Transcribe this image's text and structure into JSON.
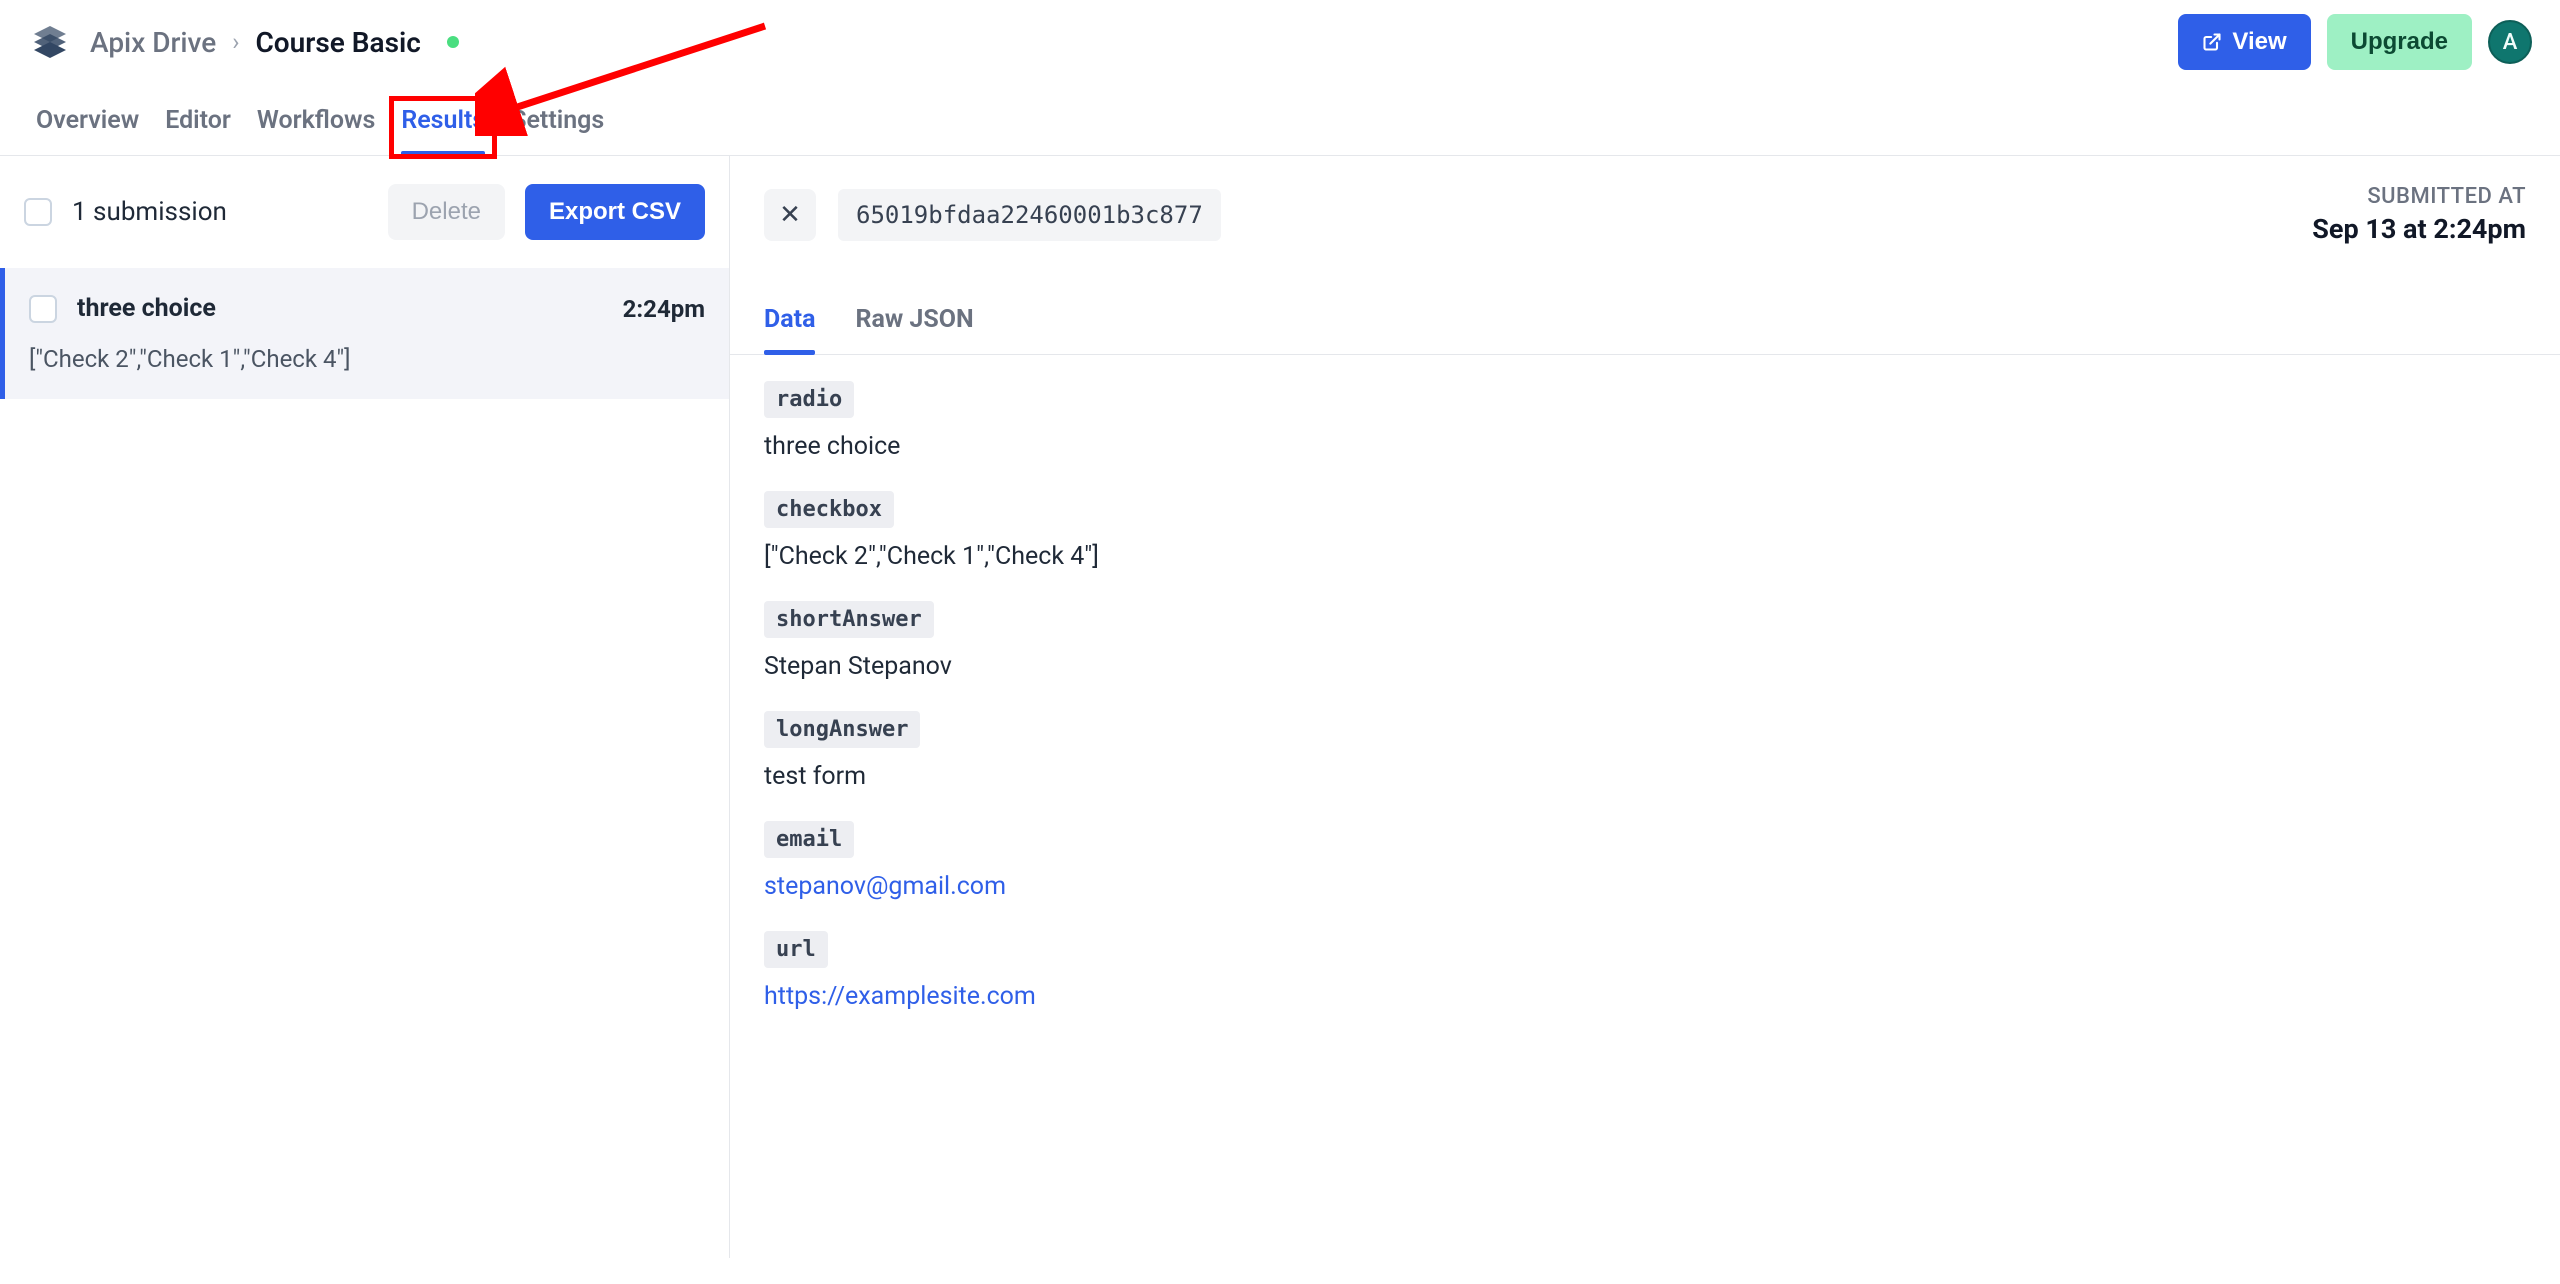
{
  "header": {
    "org": "Apix Drive",
    "title": "Course Basic",
    "view_label": "View",
    "upgrade_label": "Upgrade",
    "avatar_letter": "A"
  },
  "tabs": {
    "overview": "Overview",
    "editor": "Editor",
    "workflows": "Workflows",
    "results": "Results",
    "settings": "Settings",
    "active": "Results"
  },
  "list": {
    "count_text": "1 submission",
    "delete_label": "Delete",
    "export_label": "Export CSV",
    "items": [
      {
        "title": "three choice",
        "time": "2:24pm",
        "preview": "[\"Check 2\",\"Check 1\",\"Check 4\"]"
      }
    ]
  },
  "detail": {
    "submission_id": "65019bfdaa22460001b3c877",
    "submitted_label": "SUBMITTED AT",
    "submitted_time": "Sep 13 at 2:24pm",
    "inner_tabs": {
      "data": "Data",
      "raw": "Raw JSON",
      "active": "Data"
    },
    "fields": [
      {
        "key": "radio",
        "value": "three choice",
        "link": false
      },
      {
        "key": "checkbox",
        "value": "[\"Check 2\",\"Check 1\",\"Check 4\"]",
        "link": false
      },
      {
        "key": "shortAnswer",
        "value": "Stepan Stepanov",
        "link": false
      },
      {
        "key": "longAnswer",
        "value": "test form",
        "link": false
      },
      {
        "key": "email",
        "value": "stepanov@gmail.com",
        "link": true
      },
      {
        "key": "url",
        "value": "https://examplesite.com",
        "link": true
      }
    ]
  },
  "annotation": {
    "highlight_tab": "Results"
  }
}
